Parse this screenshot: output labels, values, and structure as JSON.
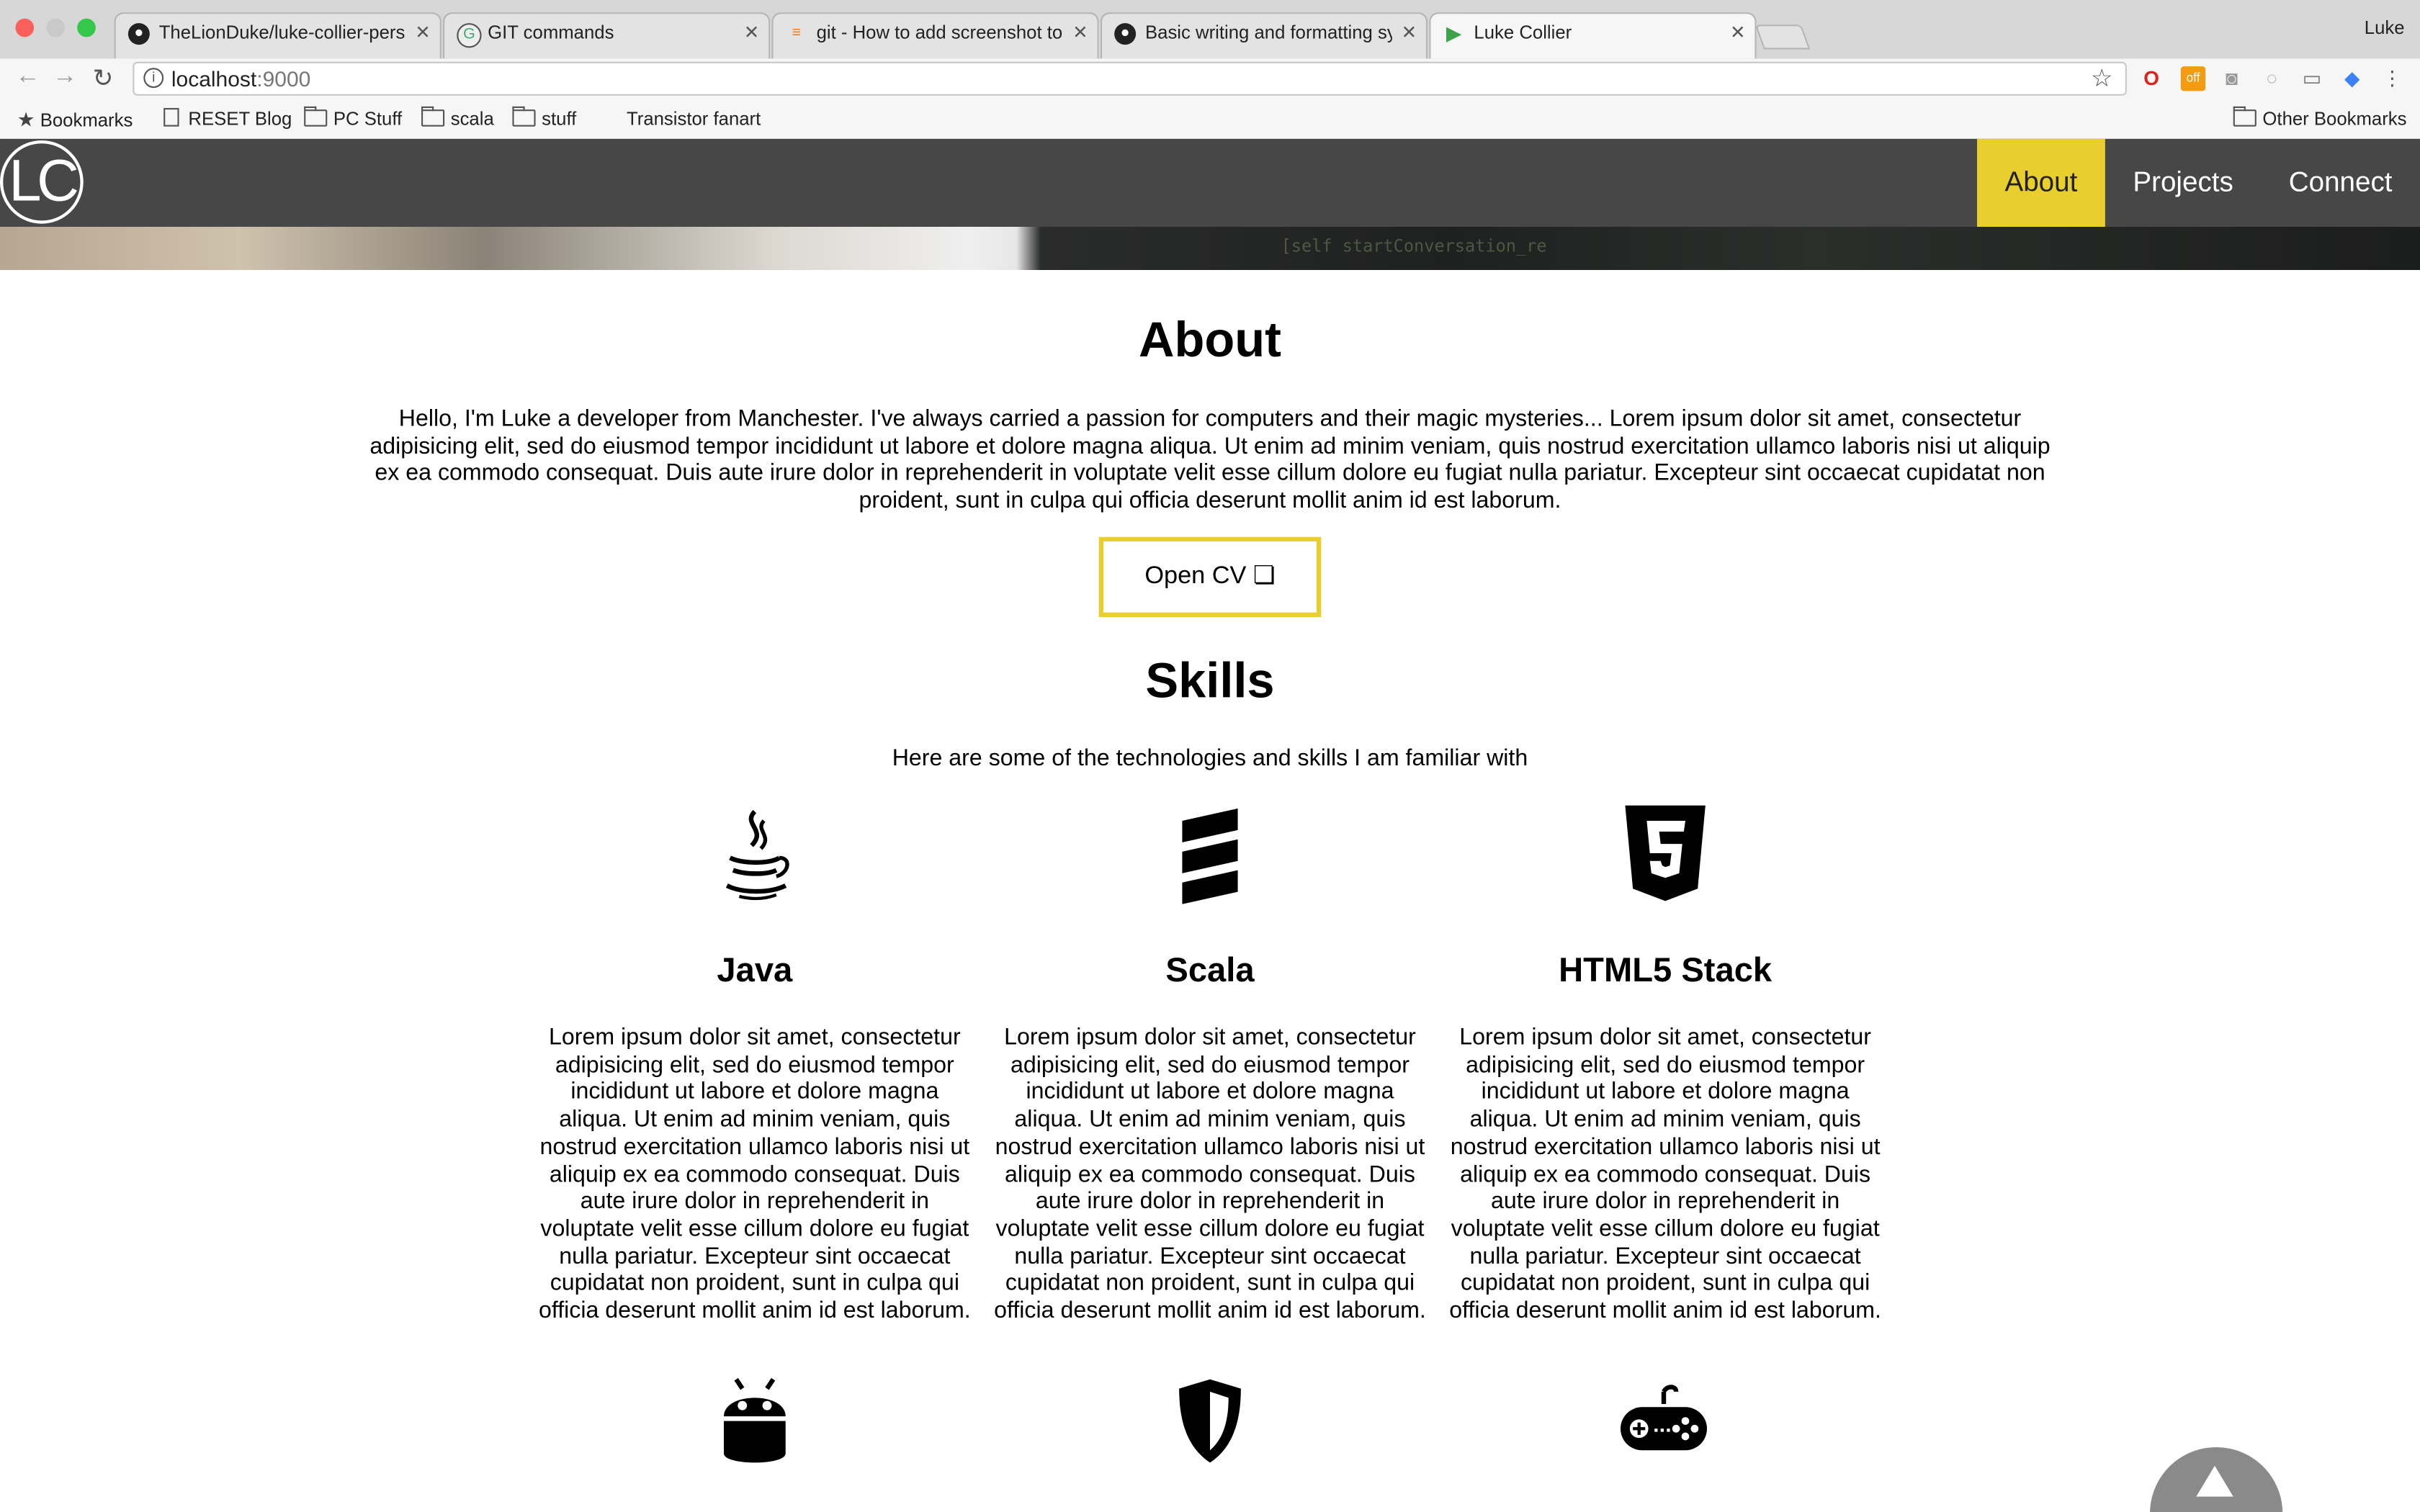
{
  "browser": {
    "tabs": [
      {
        "title": "TheLionDuke/luke-collier-pers",
        "icon": "github-icon",
        "active": false
      },
      {
        "title": "GIT commands",
        "icon": "git-icon",
        "active": false
      },
      {
        "title": "git - How to add screenshot to",
        "icon": "stackoverflow-icon",
        "active": false
      },
      {
        "title": "Basic writing and formatting sy",
        "icon": "github-icon",
        "active": false
      },
      {
        "title": "Luke Collier",
        "icon": "play-icon",
        "active": true
      }
    ],
    "profile_name": "Luke",
    "url_host": "localhost",
    "url_port": ":9000",
    "bookmarks": [
      {
        "label": "Bookmarks",
        "icon": "star-icon"
      },
      {
        "label": "RESET Blog",
        "icon": "page-icon"
      },
      {
        "label": "PC Stuff",
        "icon": "folder-icon"
      },
      {
        "label": "scala",
        "icon": "folder-icon"
      },
      {
        "label": "stuff",
        "icon": "folder-icon"
      },
      {
        "label": "Transistor fanart",
        "icon": "none"
      }
    ],
    "other_bookmarks": "Other Bookmarks"
  },
  "site": {
    "logo_text": "LC",
    "nav": [
      {
        "label": "About",
        "active": true
      },
      {
        "label": "Projects",
        "active": false
      },
      {
        "label": "Connect",
        "active": false
      }
    ],
    "hero_code_text": "[self startConversation_re",
    "about": {
      "heading": "About",
      "text": "Hello, I'm Luke a developer from Manchester. I've always carried a passion for computers and their magic mysteries... Lorem ipsum dolor sit amet, consectetur adipisicing elit, sed do eiusmod tempor incididunt ut labore et dolore magna aliqua. Ut enim ad minim veniam, quis nostrud exercitation ullamco laboris nisi ut aliquip ex ea commodo consequat. Duis aute irure dolor in reprehenderit in voluptate velit esse cillum dolore eu fugiat nulla pariatur. Excepteur sint occaecat cupidatat non proident, sunt in culpa qui officia deserunt mollit anim id est laborum.",
      "cv_button": "Open CV ❏"
    },
    "skills": {
      "heading": "Skills",
      "intro": "Here are some of the technologies and skills I am familiar with",
      "items": [
        {
          "name": "Java",
          "icon": "java-icon",
          "text": "Lorem ipsum dolor sit amet, consectetur adipisicing elit, sed do eiusmod tempor incididunt ut labore et dolore magna aliqua. Ut enim ad minim veniam, quis nostrud exercitation ullamco laboris nisi ut aliquip ex ea commodo consequat. Duis aute irure dolor in reprehenderit in voluptate velit esse cillum dolore eu fugiat nulla pariatur. Excepteur sint occaecat cupidatat non proident, sunt in culpa qui officia deserunt mollit anim id est laborum."
        },
        {
          "name": "Scala",
          "icon": "scala-icon",
          "text": "Lorem ipsum dolor sit amet, consectetur adipisicing elit, sed do eiusmod tempor incididunt ut labore et dolore magna aliqua. Ut enim ad minim veniam, quis nostrud exercitation ullamco laboris nisi ut aliquip ex ea commodo consequat. Duis aute irure dolor in reprehenderit in voluptate velit esse cillum dolore eu fugiat nulla pariatur. Excepteur sint occaecat cupidatat non proident, sunt in culpa qui officia deserunt mollit anim id est laborum."
        },
        {
          "name": "HTML5 Stack",
          "icon": "html5-icon",
          "text": "Lorem ipsum dolor sit amet, consectetur adipisicing elit, sed do eiusmod tempor incididunt ut labore et dolore magna aliqua. Ut enim ad minim veniam, quis nostrud exercitation ullamco laboris nisi ut aliquip ex ea commodo consequat. Duis aute irure dolor in reprehenderit in voluptate velit esse cillum dolore eu fugiat nulla pariatur. Excepteur sint occaecat cupidatat non proident, sunt in culpa qui officia deserunt mollit anim id est laborum."
        }
      ],
      "second_row_icons": [
        "android-icon",
        "shield-icon",
        "gamepad-icon"
      ]
    },
    "accent_color": "#e8cf2e",
    "nav_background": "#474747"
  }
}
